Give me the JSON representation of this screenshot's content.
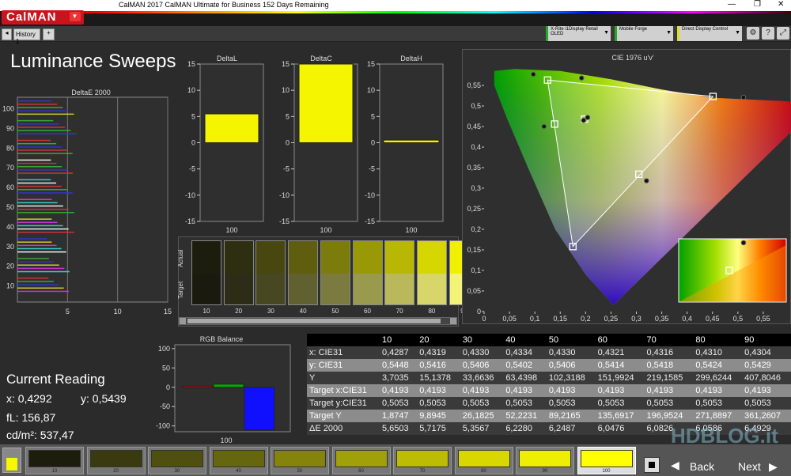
{
  "window": {
    "title": "CalMAN 2017 CalMAN Ultimate for Business 152 Days Remaining"
  },
  "app": {
    "logo": "CalMAN"
  },
  "toolbar": {
    "history_tab": "History 1",
    "devices": [
      {
        "line1": "X-Rite i1Display Retail",
        "line2": "OLED"
      },
      {
        "line1": "Mobile Forge",
        "line2": ""
      },
      {
        "line1": "Direct Display Control",
        "line2": ""
      }
    ]
  },
  "page": {
    "title": "Luminance Sweeps"
  },
  "charts": {
    "deltaE_title": "DeltaE 2000",
    "deltaL_title": "DeltaL",
    "deltaC_title": "DeltaC",
    "deltaH_title": "DeltaH",
    "cie_title": "CIE 1976 u'v'",
    "rgb_title": "RGB Balance",
    "row_actual": "Actual",
    "row_target": "Target"
  },
  "chart_data": [
    {
      "type": "bar",
      "title": "DeltaE 2000",
      "orientation": "horizontal",
      "categories": [
        "10",
        "20",
        "30",
        "40",
        "50",
        "60",
        "70",
        "80",
        "90",
        "100"
      ],
      "series": [
        {
          "values": [
            5.6503,
            5.7175,
            5.3567,
            6.228,
            6.2487,
            6.0476,
            6.0826,
            6.0586,
            6.4929,
            6.2
          ]
        }
      ],
      "xlim": [
        0,
        15
      ],
      "xticks": [
        "5",
        "10",
        "15"
      ],
      "yticks": [
        "10",
        "20",
        "30",
        "40",
        "50",
        "60",
        "70",
        "80",
        "90",
        "100"
      ]
    },
    {
      "type": "bar",
      "title": "DeltaL",
      "categories": [
        "100"
      ],
      "values": [
        5.5
      ],
      "ylim": [
        -15,
        15
      ],
      "yticks": [
        "15",
        "10",
        "5",
        "0",
        "-5",
        "-10",
        "-15"
      ]
    },
    {
      "type": "bar",
      "title": "DeltaC",
      "categories": [
        "100"
      ],
      "values": [
        15
      ],
      "ylim": [
        -15,
        15
      ],
      "yticks": [
        "15",
        "10",
        "5",
        "0",
        "-5",
        "-10",
        "-15"
      ]
    },
    {
      "type": "bar",
      "title": "DeltaH",
      "categories": [
        "100"
      ],
      "values": [
        0.5
      ],
      "ylim": [
        -15,
        15
      ],
      "yticks": [
        "15",
        "10",
        "5",
        "0",
        "-5",
        "-10",
        "-15"
      ]
    },
    {
      "type": "bar",
      "title": "RGB Balance",
      "categories": [
        "100"
      ],
      "series": [
        {
          "values": [
            3
          ],
          "color": "#e00000"
        },
        {
          "values": [
            8
          ],
          "color": "#00b000"
        },
        {
          "values": [
            -110
          ],
          "color": "#1010ff"
        }
      ],
      "ylim": [
        -115,
        110
      ],
      "yticks": [
        "100",
        "50",
        "0",
        "-50",
        "-100"
      ]
    },
    {
      "type": "scatter",
      "title": "CIE 1976 u'v'",
      "xlim": [
        0,
        0.6
      ],
      "ylim": [
        0,
        0.6
      ],
      "xticks": [
        "0",
        "0,05",
        "0,1",
        "0,15",
        "0,2",
        "0,25",
        "0,3",
        "0,35",
        "0,4",
        "0,45",
        "0,5",
        "0,55"
      ],
      "yticks": [
        "0,55",
        "0,5",
        "0,45",
        "0,4",
        "0,35",
        "0,3",
        "0,25",
        "0,2",
        "0,15",
        "0,1",
        "0,05",
        "0"
      ],
      "targets": [
        [
          0.451,
          0.523
        ],
        [
          0.125,
          0.563
        ],
        [
          0.175,
          0.158
        ],
        [
          0.198,
          0.468
        ],
        [
          0.139,
          0.456
        ],
        [
          0.305,
          0.334
        ]
      ],
      "measured": [
        [
          0.511,
          0.521
        ],
        [
          0.097,
          0.577
        ],
        [
          0.192,
          0.568
        ],
        [
          0.196,
          0.465
        ],
        [
          0.204,
          0.472
        ],
        [
          0.118,
          0.45
        ],
        [
          0.32,
          0.318
        ]
      ]
    }
  ],
  "swatch_rows": {
    "labels": [
      "10",
      "20",
      "30",
      "40",
      "50",
      "60",
      "70",
      "80",
      "90"
    ],
    "actual": [
      "#1d1d0e",
      "#2e2e10",
      "#47470f",
      "#5e5e0e",
      "#7c7c0d",
      "#999908",
      "#b8b804",
      "#d6d600",
      "#f0f000"
    ],
    "target": [
      "#1a1a0f",
      "#2d2d17",
      "#474722",
      "#606030",
      "#7b7b3f",
      "#9a9a4e",
      "#b9b95c",
      "#d6d66b",
      "#f3f37a"
    ]
  },
  "reading": {
    "heading": "Current Reading",
    "x": "x: 0,4292",
    "y": "y: 0,5439",
    "fl": "fL: 156,87",
    "cdm2": "cd/m²: 537,47"
  },
  "table": {
    "header": [
      "",
      "10",
      "20",
      "30",
      "40",
      "50",
      "60",
      "70",
      "80",
      "90"
    ],
    "rows": [
      [
        "x: CIE31",
        "0,4287",
        "0,4319",
        "0,4330",
        "0,4334",
        "0,4330",
        "0,4321",
        "0,4316",
        "0,4310",
        "0,4304"
      ],
      [
        "y: CIE31",
        "0,5448",
        "0,5416",
        "0,5406",
        "0,5402",
        "0,5406",
        "0,5414",
        "0,5418",
        "0,5424",
        "0,5429"
      ],
      [
        "Y",
        "3,7035",
        "15,1378",
        "33,6636",
        "63,4398",
        "102,3188",
        "151,9924",
        "219,1585",
        "299,6244",
        "407,8046"
      ],
      [
        "Target x:CIE31",
        "0,4193",
        "0,4193",
        "0,4193",
        "0,4193",
        "0,4193",
        "0,4193",
        "0,4193",
        "0,4193",
        "0,4193"
      ],
      [
        "Target y:CIE31",
        "0,5053",
        "0,5053",
        "0,5053",
        "0,5053",
        "0,5053",
        "0,5053",
        "0,5053",
        "0,5053",
        "0,5053"
      ],
      [
        "Target Y",
        "1,8747",
        "9,8945",
        "26,1825",
        "52,2231",
        "89,2165",
        "135,6917",
        "196,9524",
        "271,8897",
        "361,2607"
      ],
      [
        "ΔE 2000",
        "5,6503",
        "5,7175",
        "5,3567",
        "6,2280",
        "6,2487",
        "6,0476",
        "6,0826",
        "6,0586",
        "6,4929"
      ]
    ]
  },
  "footer": {
    "swatches": [
      "10",
      "20",
      "30",
      "40",
      "50",
      "60",
      "70",
      "80",
      "90",
      "100"
    ],
    "swatch_colors": [
      "#1d1d0e",
      "#3a3a10",
      "#4f4f0f",
      "#66660e",
      "#84840d",
      "#a0a008",
      "#bcbc04",
      "#d8d800",
      "#eeee00",
      "#ffff00"
    ],
    "back": "Back",
    "next": "Next"
  },
  "watermark": "HDBLOG.it"
}
